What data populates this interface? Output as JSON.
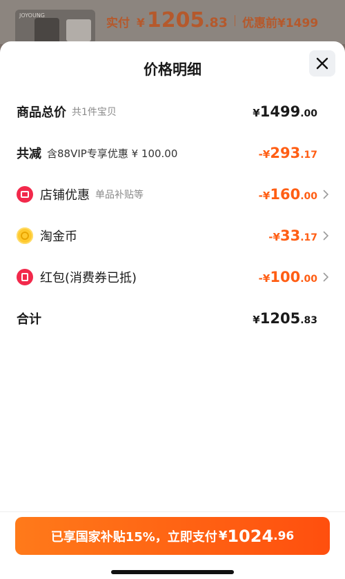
{
  "top": {
    "thumb_brand": "JOYOUNG",
    "paid_label": "实付",
    "paid_currency": "¥",
    "paid_int": "1205",
    "paid_dec": ".83",
    "orig_label": "优惠前",
    "orig_price": "¥1499"
  },
  "sheet": {
    "title": "价格明细",
    "rows": {
      "total": {
        "label": "商品总价",
        "sub": "共1件宝贝",
        "currency": "¥",
        "int": "1499",
        "dec": ".00"
      },
      "reduce": {
        "label": "共减",
        "sub": "含88VIP专享优惠 ¥ 100.00",
        "currency": "-¥",
        "int": "293",
        "dec": ".17"
      },
      "shop": {
        "label": "店铺优惠",
        "sub": "单品补贴等",
        "currency": "-¥",
        "int": "160",
        "dec": ".00",
        "icon": "shop-icon"
      },
      "coin": {
        "label": "淘金币",
        "currency": "-¥",
        "int": "33",
        "dec": ".17",
        "icon": "coin-icon"
      },
      "redpacket": {
        "label": "红包(消费券已抵)",
        "currency": "-¥",
        "int": "100",
        "dec": ".00",
        "icon": "red-packet-icon"
      },
      "sum": {
        "label": "合计",
        "currency": "¥",
        "int": "1205",
        "dec": ".83"
      }
    }
  },
  "footer": {
    "pay_text": "已享国家补贴15%，立即支付",
    "currency": "¥",
    "int": "1024",
    "dec": ".96"
  },
  "colors": {
    "accent": "#ff5e14",
    "button_start": "#ff7a1a",
    "button_end": "#ff4f0e"
  }
}
